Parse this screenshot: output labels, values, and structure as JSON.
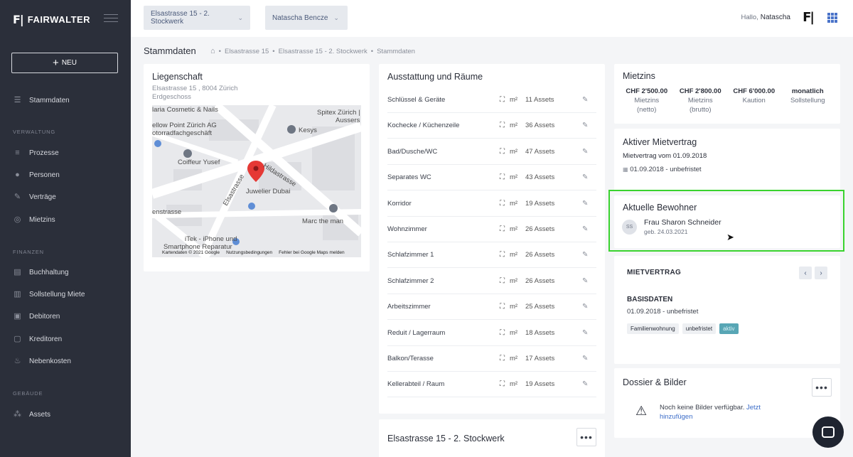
{
  "app": {
    "logo_mark": "F|",
    "logo_text": "FAIRWALTER"
  },
  "sidebar": {
    "new_button": "NEU",
    "items_top": [
      {
        "label": "Stammdaten",
        "icon": "database-icon"
      }
    ],
    "sections": [
      {
        "title": "VERWALTUNG",
        "items": [
          {
            "label": "Prozesse",
            "icon": "list-icon"
          },
          {
            "label": "Personen",
            "icon": "people-icon"
          },
          {
            "label": "Verträge",
            "icon": "contract-icon"
          },
          {
            "label": "Mietzins",
            "icon": "money-icon"
          }
        ]
      },
      {
        "title": "FINANZEN",
        "items": [
          {
            "label": "Buchhaltung",
            "icon": "ledger-icon"
          },
          {
            "label": "Sollstellung Miete",
            "icon": "invoice-icon"
          },
          {
            "label": "Debitoren",
            "icon": "debtors-icon"
          },
          {
            "label": "Kreditoren",
            "icon": "creditors-icon"
          },
          {
            "label": "Nebenkosten",
            "icon": "flame-icon"
          }
        ]
      },
      {
        "title": "GEBÄUDE",
        "items": [
          {
            "label": "Assets",
            "icon": "assets-icon"
          }
        ]
      }
    ]
  },
  "topbar": {
    "property_select": "Elsastrasse 15 - 2. Stockwerk",
    "person_select": "Natascha Bencze",
    "greeting": "Hallo,",
    "user_name": "Natascha"
  },
  "page": {
    "title": "Stammdaten",
    "breadcrumb": [
      "Elsastrasse 15",
      "Elsastrasse 15 - 2. Stockwerk",
      "Stammdaten"
    ]
  },
  "liegenschaft": {
    "title": "Liegenschaft",
    "address": "Elsastrasse 15 , 8004 Zürich",
    "floor": "Erdgeschoss",
    "map_labels": {
      "cosmetic": "laria Cosmetic & Nails",
      "spitex": "Spitex Zürich |",
      "aussers": "Aussers",
      "yellow_point": "ellow Point Zürich AG",
      "motor": "otorradfachgeschäft",
      "kesys": "Kesys",
      "coiffeur": "Coiffeur Yusef",
      "hildastrasse": "Hildastrasse",
      "elsastrasse": "Elsastrasse",
      "jeweler": "Juwelier Dubai",
      "nstrasse": "enstrasse",
      "marc": "Marc the man",
      "itek": "iTek - iPhone und",
      "smartphone": "Smartphone Reparatur",
      "footer_1": "Kartendaten © 2021 Google",
      "footer_2": "Nutzungsbedingungen",
      "footer_3": "Fehler bei Google Maps melden"
    }
  },
  "ausstattung": {
    "title": "Ausstattung und Räume",
    "unit": "m²",
    "rows": [
      {
        "name": "Schlüssel & Geräte",
        "assets": "11 Assets"
      },
      {
        "name": "Kochecke / Küchenzeile",
        "assets": "36 Assets"
      },
      {
        "name": "Bad/Dusche/WC",
        "assets": "47 Assets"
      },
      {
        "name": "Separates WC",
        "assets": "43 Assets"
      },
      {
        "name": "Korridor",
        "assets": "19 Assets"
      },
      {
        "name": "Wohnzimmer",
        "assets": "26 Assets"
      },
      {
        "name": "Schlafzimmer 1",
        "assets": "26 Assets"
      },
      {
        "name": "Schlafzimmer 2",
        "assets": "26 Assets"
      },
      {
        "name": "Arbeitszimmer",
        "assets": "25 Assets"
      },
      {
        "name": "Reduit / Lagerraum",
        "assets": "18 Assets"
      },
      {
        "name": "Balkon/Terasse",
        "assets": "17 Assets"
      },
      {
        "name": "Kellerabteil / Raum",
        "assets": "19 Assets"
      }
    ]
  },
  "objekt": {
    "title": "Elsastrasse 15 - 2. Stockwerk",
    "more": "•••"
  },
  "mietzins": {
    "title": "Mietzins",
    "cols": [
      {
        "value": "CHF 2'500.00",
        "label1": "Mietzins",
        "label2": "(netto)"
      },
      {
        "value": "CHF 2'800.00",
        "label1": "Mietzins",
        "label2": "(brutto)"
      },
      {
        "value": "CHF 6'000.00",
        "label1": "Kaution",
        "label2": ""
      },
      {
        "value": "monatlich",
        "label1": "Sollstellung",
        "label2": ""
      }
    ]
  },
  "aktiver_mietvertrag": {
    "title": "Aktiver Mietvertrag",
    "line1": "Mietvertrag vom 01.09.2018",
    "line2": "01.09.2018 - unbefristet"
  },
  "bewohner": {
    "title": "Aktuelle Bewohner",
    "initials": "SS",
    "name": "Frau Sharon Schneider",
    "born": "geb. 24.03.2021"
  },
  "mietvertrag": {
    "title": "MIETVERTRAG",
    "prev": "‹",
    "next": "›",
    "sub_title": "BASISDATEN",
    "date": "01.09.2018 - unbefristet",
    "tags": [
      "Familienwohnung",
      "unbefristet"
    ],
    "status": "aktiv"
  },
  "dossier": {
    "title": "Dossier & Bilder",
    "more": "•••",
    "message": "Noch keine Bilder verfügbar.",
    "link": "Jetzt hinzufügen"
  }
}
